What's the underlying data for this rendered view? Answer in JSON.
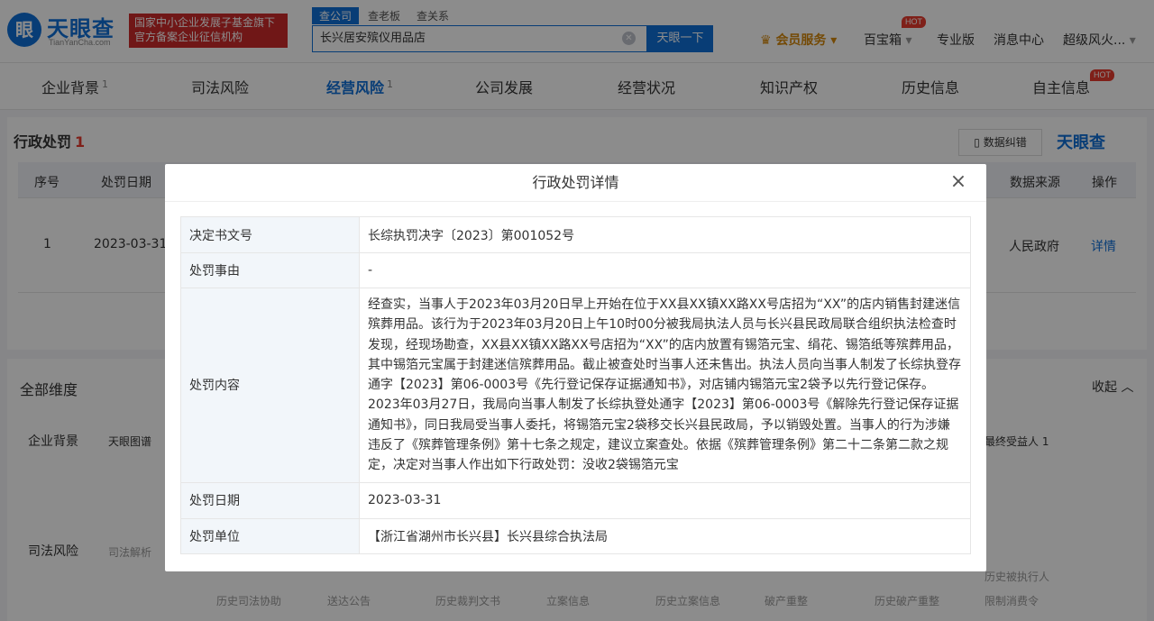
{
  "header": {
    "logo_mark": "眼",
    "logo_name": "天眼查",
    "logo_sub": "TianYanCha.com",
    "slogan_line1": "国家中小企业发展子基金旗下",
    "slogan_line2": "官方备案企业征信机构",
    "search_tabs": [
      "查公司",
      "查老板",
      "查关系"
    ],
    "search_value": "长兴居安殡仪用品店",
    "search_button": "天眼一下",
    "vip": "会员服务",
    "nav": [
      "百宝箱",
      "专业版",
      "消息中心",
      "超级风火..."
    ],
    "hot": "HOT"
  },
  "tabs": [
    {
      "label": "企业背景",
      "count": "1"
    },
    {
      "label": "司法风险",
      "count": ""
    },
    {
      "label": "经营风险",
      "count": "1"
    },
    {
      "label": "公司发展",
      "count": ""
    },
    {
      "label": "经营状况",
      "count": ""
    },
    {
      "label": "知识产权",
      "count": ""
    },
    {
      "label": "历史信息",
      "count": ""
    },
    {
      "label": "自主信息",
      "count": ""
    }
  ],
  "section": {
    "title": "行政处罚",
    "count": "1",
    "feedback_button": "数据纠错",
    "watermark": "天眼查"
  },
  "table": {
    "headers": [
      "序号",
      "处罚日期",
      "数据来源",
      "操作"
    ],
    "row": {
      "index": "1",
      "date": "2023-03-31",
      "source": "人民政府",
      "action": "详情"
    }
  },
  "dimensions": {
    "title": "全部维度",
    "collapse": "收起",
    "groups": [
      {
        "label": "企业背景",
        "items": [
          "天眼图谱",
          "最终受益人 1"
        ]
      },
      {
        "label": "司法风险",
        "items": [
          "司法解析",
          "历史司法协助",
          "送达公告",
          "历史裁判文书",
          "立案信息",
          "历史立案信息",
          "破产重整",
          "历史破产重整",
          "历史被执行人",
          "限制消费令"
        ]
      }
    ]
  },
  "modal": {
    "title": "行政处罚详情",
    "close": "×",
    "rows": [
      {
        "key": "决定书文号",
        "value": "长综执罚决字〔2023〕第001052号"
      },
      {
        "key": "处罚事由",
        "value": "-"
      },
      {
        "key": "处罚内容",
        "value": "经查实，当事人于2023年03月20日早上开始在位于XX县XX镇XX路XX号店招为“XX”的店内销售封建迷信殡葬用品。该行为于2023年03月20日上午10时00分被我局执法人员与长兴县民政局联合组织执法检查时发现，经现场勘查，XX县XX镇XX路XX号店招为“XX”的店内放置有锡箔元宝、绢花、锡箔纸等殡葬用品，其中锡箔元宝属于封建迷信殡葬用品。截止被查处时当事人还未售出。执法人员向当事人制发了长综执登存通字【2023】第06-0003号《先行登记保存证据通知书》，对店铺内锡箔元宝2袋予以先行登记保存。2023年03月27日，我局向当事人制发了长综执登处通字【2023】第06-0003号《解除先行登记保存证据通知书》，同日我局受当事人委托，将锡箔元宝2袋移交长兴县民政局，予以销毁处置。当事人的行为涉嫌违反了《殡葬管理条例》第十七条之规定，建议立案查处。依据《殡葬管理条例》第二十二条第二款之规定，决定对当事人作出如下行政处罚：没收2袋锡箔元宝"
      },
      {
        "key": "处罚日期",
        "value": "2023-03-31"
      },
      {
        "key": "处罚单位",
        "value": "【浙江省湖州市长兴县】长兴县综合执法局"
      }
    ]
  },
  "colors": {
    "brand": "#0f6fd8",
    "hot": "#e83b2e",
    "vip": "#d4880c"
  }
}
